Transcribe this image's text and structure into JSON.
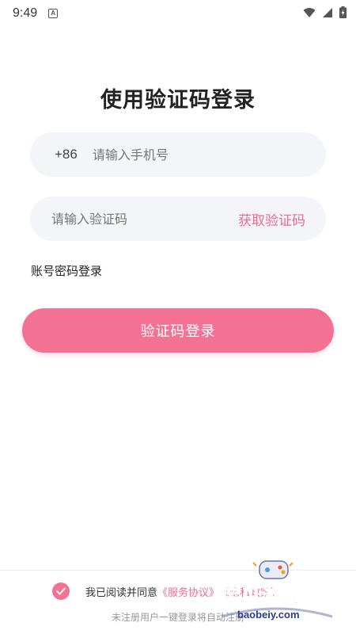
{
  "status_bar": {
    "time": "9:49",
    "notification_glyph": "A",
    "icons": [
      "wifi-icon",
      "signal-icon",
      "battery-charging-icon"
    ]
  },
  "login": {
    "title": "使用验证码登录",
    "phone": {
      "country_code": "+86",
      "placeholder": "请输入手机号",
      "value": ""
    },
    "code": {
      "placeholder": "请输入验证码",
      "value": "",
      "get_code_label": "获取验证码"
    },
    "password_login_label": "账号密码登录",
    "submit_label": "验证码登录"
  },
  "agreement": {
    "checked": true,
    "prefix": "我已阅读并同意",
    "service_link": "《服务协议》",
    "privacy_link": "《隐私政策》",
    "note": "未注册用户一键登录将自动注册"
  },
  "watermark": {
    "text": "宝贝游戏网",
    "url": "baobeiy.com"
  },
  "colors": {
    "accent": "#f37293",
    "link": "#f06a8f",
    "field_bg": "#f4f5f9"
  }
}
